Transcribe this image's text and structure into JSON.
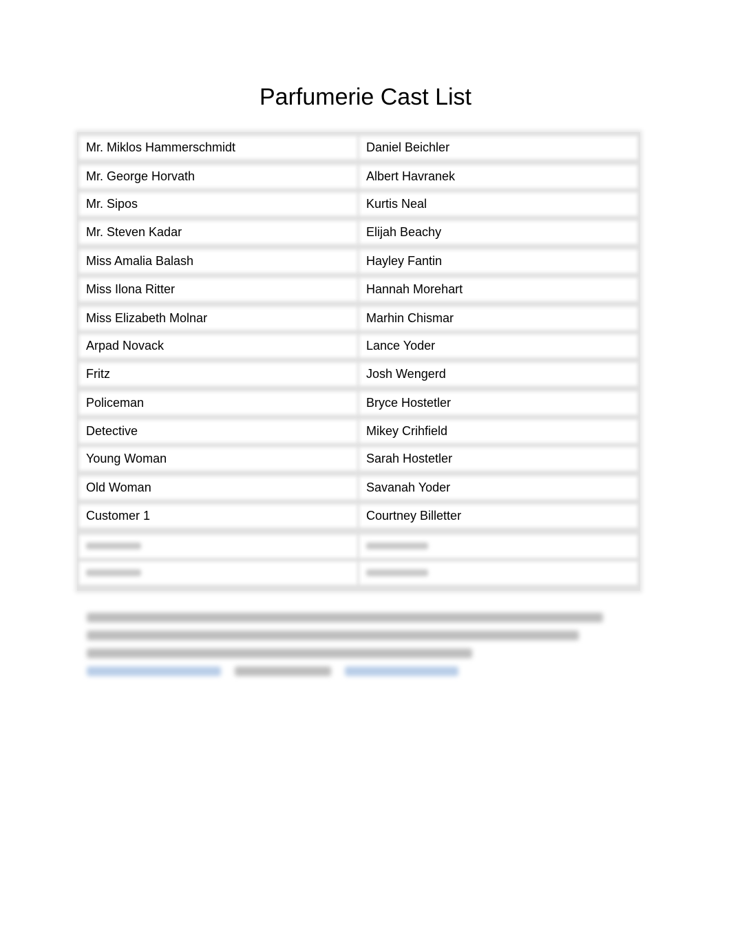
{
  "title": "Parfumerie Cast List",
  "cast": [
    {
      "role": "Mr. Miklos Hammerschmidt",
      "actor": "Daniel Beichler"
    },
    {
      "role": "Mr. George Horvath",
      "actor": "Albert Havranek"
    },
    {
      "role": "Mr. Sipos",
      "actor": "Kurtis Neal"
    },
    {
      "role": "Mr. Steven Kadar",
      "actor": "Elijah Beachy"
    },
    {
      "role": "Miss Amalia Balash",
      "actor": "Hayley Fantin"
    },
    {
      "role": "Miss Ilona Ritter",
      "actor": "Hannah Morehart"
    },
    {
      "role": "Miss Elizabeth Molnar",
      "actor": "Marhin Chismar"
    },
    {
      "role": "Arpad Novack",
      "actor": "Lance Yoder"
    },
    {
      "role": "Fritz",
      "actor": "Josh Wengerd"
    },
    {
      "role": "Policeman",
      "actor": "Bryce Hostetler"
    },
    {
      "role": "Detective",
      "actor": "Mikey Crihfield"
    },
    {
      "role": "Young Woman",
      "actor": "Sarah Hostetler"
    },
    {
      "role": "Old Woman",
      "actor": "Savanah Yoder"
    },
    {
      "role": "Customer 1",
      "actor": "Courtney Billetter"
    }
  ],
  "blurred_rows": 2,
  "colors": {
    "link": "#b8cde8",
    "grid": "#e2e2e2"
  }
}
